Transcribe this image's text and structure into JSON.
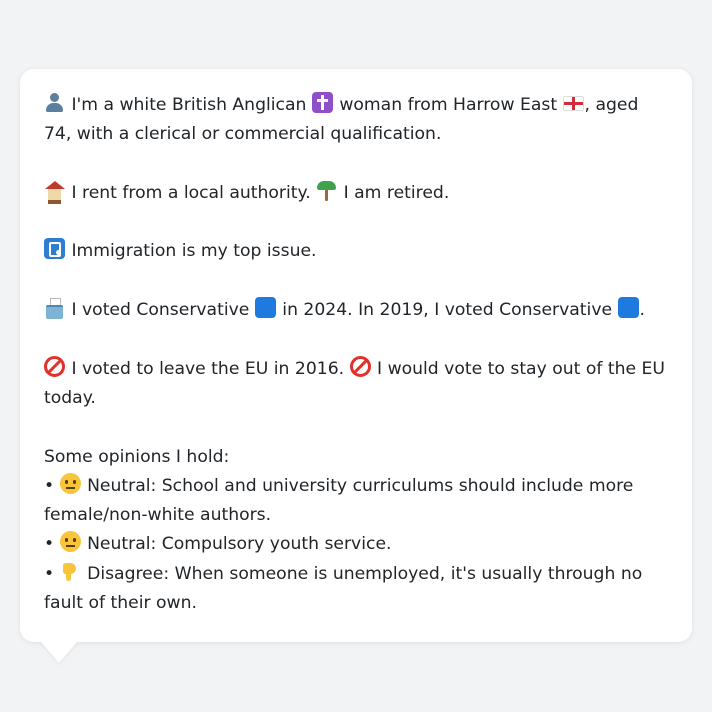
{
  "profile": {
    "intro": {
      "icon": "person-silhouette-icon",
      "part1": "I'm a white British Anglican",
      "religion_icon": "latin-cross-icon",
      "part2": "woman from Harrow East",
      "flag_icon": "england-flag-icon",
      "part3": ", aged 74, with a clerical or commercial qualification."
    },
    "housing": {
      "icon": "house-icon",
      "text": "I rent from a local authority.",
      "work_icon": "palm-tree-icon",
      "work_text": "I am retired."
    },
    "issue": {
      "icon": "passport-control-icon",
      "text": "Immigration is my top issue."
    },
    "vote": {
      "icon": "ballot-box-icon",
      "part1": "I voted Conservative",
      "party_icon": "blue-square-icon",
      "part2": "in 2024. In 2019, I voted Conservative",
      "party_color": "#1f7ae0",
      "end": "."
    },
    "eu": {
      "icon": "no-entry-icon",
      "text1": "I voted to leave the EU in 2016.",
      "text2": "I would vote to stay out of the EU today."
    },
    "opinions": {
      "heading": "Some opinions I hold:",
      "bullet": "•",
      "items": [
        {
          "icon": "neutral-face-icon",
          "text": "Neutral: School and university curriculums should include more female/non-white authors."
        },
        {
          "icon": "neutral-face-icon",
          "text": "Neutral: Compulsory youth service."
        },
        {
          "icon": "thumbs-down-icon",
          "text": "Disagree: When someone is unemployed, it's usually through no fault of their own."
        }
      ]
    }
  }
}
